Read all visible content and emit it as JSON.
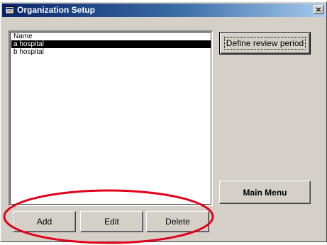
{
  "window": {
    "title": "Organization Setup",
    "close_glyph": "×"
  },
  "list": {
    "header": "Name",
    "items": [
      "a hospital",
      "b hospital"
    ],
    "selected_index": 0
  },
  "buttons": {
    "define_review_period": "Define review period",
    "main_menu": "Main Menu",
    "add": "Add",
    "edit": "Edit",
    "delete": "Delete"
  },
  "colors": {
    "annotation_circle": "#e0001b",
    "title_bar_start": "#0a246a",
    "dialog_face": "#d4d0c8"
  },
  "icons": {
    "window_icon": "form-icon",
    "close": "close-icon"
  }
}
